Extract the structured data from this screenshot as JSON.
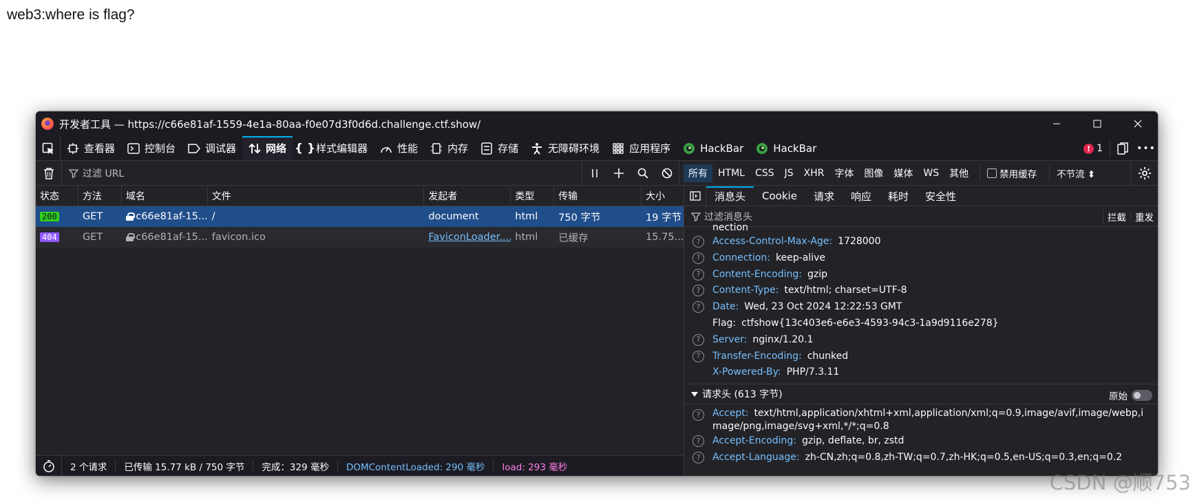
{
  "page": {
    "text": "web3:where is flag?"
  },
  "window": {
    "title": "开发者工具 — https://c66e81af-1559-4e1a-80aa-f0e07d3f0d6d.challenge.ctf.show/",
    "minimize": "—",
    "maximize": "☐",
    "close": "✕"
  },
  "toolbar": {
    "tabs": [
      {
        "label": "查看器"
      },
      {
        "label": "控制台"
      },
      {
        "label": "调试器"
      },
      {
        "label": "网络"
      },
      {
        "label": "样式编辑器"
      },
      {
        "label": "性能"
      },
      {
        "label": "内存"
      },
      {
        "label": "存储"
      },
      {
        "label": "无障碍环境"
      },
      {
        "label": "应用程序"
      },
      {
        "label": "HackBar"
      },
      {
        "label": "HackBar"
      }
    ],
    "error_count": "1",
    "more": "•••"
  },
  "filterbar": {
    "url_placeholder": "过滤 URL",
    "types": [
      "所有",
      "HTML",
      "CSS",
      "JS",
      "XHR",
      "字体",
      "图像",
      "媒体",
      "WS",
      "其他"
    ],
    "disable_cache": "禁用缓存",
    "throttle": "不节流 ⬍"
  },
  "table": {
    "columns": [
      "状态",
      "方法",
      "域名",
      "文件",
      "发起者",
      "类型",
      "传输",
      "大小"
    ],
    "rows": [
      {
        "status": "200",
        "method": "GET",
        "domain": "c66e81af-15...",
        "file": "/",
        "initiator": "document",
        "type": "html",
        "transfer": "750 字节",
        "size": "19 字节"
      },
      {
        "status": "404",
        "method": "GET",
        "domain": "c66e81af-15...",
        "file": "favicon.ico",
        "initiator": "FaviconLoader....",
        "type": "html",
        "transfer": "已缓存",
        "size": "15.75..."
      }
    ]
  },
  "statusbar": {
    "requests": "2 个请求",
    "transferred": "已传输 15.77 kB / 750 字节",
    "finish": "完成：329 毫秒",
    "dom": "DOMContentLoaded: 290 毫秒",
    "load": "load: 293 毫秒"
  },
  "details": {
    "tabs": [
      "消息头",
      "Cookie",
      "请求",
      "响应",
      "耗时",
      "安全性"
    ],
    "filter_placeholder": "过滤消息头",
    "block": "拦截",
    "resend": "重发",
    "partial_top": "nection",
    "response_headers": [
      {
        "name": "Access-Control-Max-Age:",
        "value": "1728000"
      },
      {
        "name": "Connection:",
        "value": "keep-alive"
      },
      {
        "name": "Content-Encoding:",
        "value": "gzip"
      },
      {
        "name": "Content-Type:",
        "value": "text/html; charset=UTF-8"
      },
      {
        "name": "Date:",
        "value": "Wed, 23 Oct 2024 12:22:53 GMT"
      },
      {
        "name": "Flag:",
        "value": "ctfshow{13c403e6-e6e3-4593-94c3-1a9d9116e278}"
      },
      {
        "name": "Server:",
        "value": "nginx/1.20.1"
      },
      {
        "name": "Transfer-Encoding:",
        "value": "chunked"
      },
      {
        "name": "X-Powered-By:",
        "value": "PHP/7.3.11"
      }
    ],
    "request_section": "请求头 (613 字节)",
    "raw": "原始",
    "request_headers": [
      {
        "name": "Accept:",
        "value": "text/html,application/xhtml+xml,application/xml;q=0.9,image/avif,image/webp,image/png,image/svg+xml,*/*;q=0.8"
      },
      {
        "name": "Accept-Encoding:",
        "value": "gzip, deflate, br, zstd"
      },
      {
        "name": "Accept-Language:",
        "value": "zh-CN,zh;q=0.8,zh-TW;q=0.7,zh-HK;q=0.5,en-US;q=0.3,en;q=0.2"
      }
    ]
  },
  "watermark": "CSDN @顺753"
}
